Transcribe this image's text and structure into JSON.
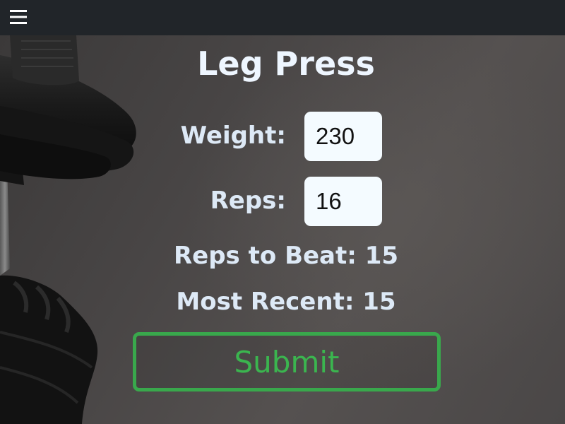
{
  "navbar": {
    "menu_icon": "hamburger-menu-icon"
  },
  "exercise": {
    "title": "Leg Press"
  },
  "form": {
    "weight_label": "Weight:",
    "weight_value": "230",
    "reps_label": "Reps:",
    "reps_value": "16"
  },
  "stats": {
    "reps_to_beat_label": "Reps to Beat:",
    "reps_to_beat_value": "15",
    "most_recent_label": "Most Recent:",
    "most_recent_value": "15"
  },
  "actions": {
    "submit_label": "Submit"
  },
  "colors": {
    "navbar_bg": "#212529",
    "accent_green": "#3bb54f",
    "text": "#dde9f6",
    "input_bg": "#f4fbff"
  },
  "background": {
    "description_icons": [
      "dumbbell-icon",
      "glove-icon"
    ]
  }
}
